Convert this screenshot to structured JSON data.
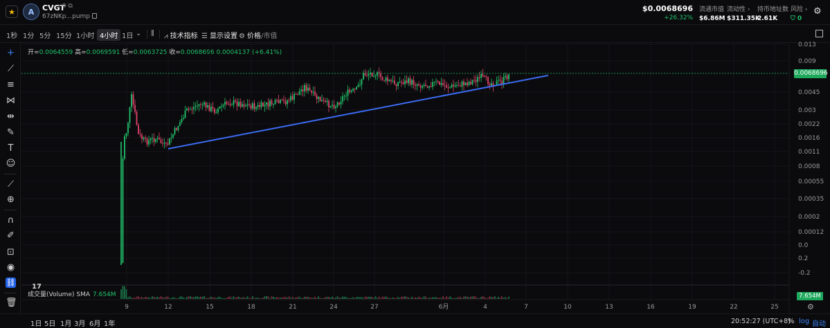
{
  "header": {
    "token_symbol": "CVGT",
    "token_address": "67zNKp...pump",
    "logo_letter": "A",
    "price": "$0.0068696",
    "change": "+26.32%",
    "stats": [
      {
        "label": "流通市值",
        "value": "$6.86M"
      },
      {
        "label": "流动性 ›",
        "value": "$311.35K"
      },
      {
        "label": "持币地址数",
        "value": "2.61K"
      },
      {
        "label": "风险 ›",
        "value": "0"
      }
    ]
  },
  "toolbar": {
    "timeframes": [
      "1秒",
      "1分",
      "5分",
      "15分",
      "1小时",
      "4小时",
      "1日"
    ],
    "active_timeframe": "4小时",
    "indicators": "技术指标",
    "display_settings": "显示设置",
    "price": "价格",
    "market_cap": "市值"
  },
  "ohlc": {
    "open_label": "开",
    "open": "0.0064559",
    "high_label": "高",
    "high": "0.0069591",
    "low_label": "低",
    "low": "0.0063725",
    "close_label": "收",
    "close": "0.0068696",
    "delta": "0.0004137 (+6.41%)"
  },
  "volume": {
    "label": "成交量(Volume)",
    "sma_label": "SMA",
    "sma_value": "7.654M",
    "tag": "7.654M"
  },
  "current_price_tag": "0.0068696",
  "bottom": {
    "ranges": [
      "1日",
      "5日",
      "1月",
      "3月",
      "6月",
      "1年"
    ],
    "clock": "20:52:27 (UTC+8)",
    "pct": "%",
    "log": "log",
    "auto": "自动"
  },
  "colors": {
    "up": "#21c36b",
    "down": "#e0456b",
    "trendline": "#3b6cf6",
    "accent": "#2563eb"
  },
  "icons": [
    "star-icon",
    "crosshair-icon",
    "trendline-icon",
    "fib-icon",
    "pattern-icon",
    "measure-icon",
    "brush-icon",
    "text-icon",
    "emoji-icon",
    "ruler-icon",
    "zoom-icon",
    "magnet-icon",
    "lock-draw-icon",
    "lock-icon",
    "eye-icon",
    "link-icon",
    "trash-icon",
    "gear-icon"
  ],
  "chart_data": {
    "type": "candlestick",
    "scale": "log",
    "price_axis_ticks": [
      "0.013",
      "0.009",
      "0.0068696",
      "0.0045",
      "0.003",
      "0.0022",
      "0.0016",
      "0.0011",
      "0.0008",
      "0.00055",
      "0.00035",
      "0.0002",
      "0.00012",
      "0.0",
      "0.2",
      "-0.2"
    ],
    "time_axis_ticks": [
      "9",
      "12",
      "15",
      "18",
      "21",
      "24",
      "27",
      "6月",
      "4",
      "7",
      "10",
      "13",
      "16",
      "19",
      "22",
      "25"
    ],
    "approx_close_series_note_omitted": true
  }
}
